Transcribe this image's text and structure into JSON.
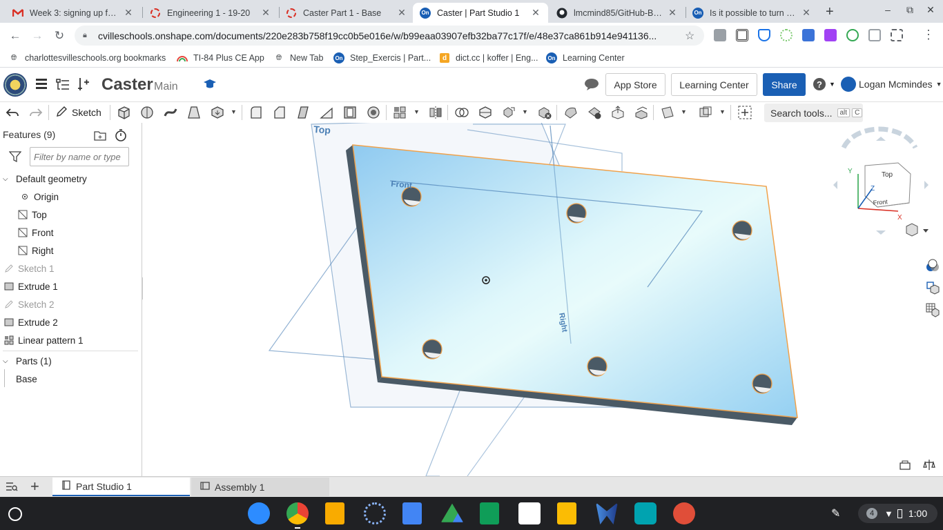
{
  "browser": {
    "tabs": [
      {
        "title": "Week 3: signing up for W",
        "favicon": "gmail-icon"
      },
      {
        "title": "Engineering 1 - 19-20",
        "favicon": "ring-icon"
      },
      {
        "title": "Caster Part 1 - Base",
        "favicon": "ring-icon"
      },
      {
        "title": "Caster | Part Studio 1",
        "favicon": "onshape-icon",
        "active": true
      },
      {
        "title": "lmcmind85/GitHub-Basi",
        "favicon": "github-icon"
      },
      {
        "title": "Is it possible to turn off s",
        "favicon": "onshape-icon"
      }
    ],
    "new_tab": "+",
    "url": "cvilleschools.onshape.com/documents/220e283b758f19cc0b5e016e/w/b99eaa03907efb32ba77c17f/e/48e37ca861b914e941136...",
    "bookmarks": [
      {
        "label": "charlottesvilleschools.org bookmarks",
        "icon": "globe-icon"
      },
      {
        "label": "TI-84 Plus CE App",
        "icon": "rainbow-icon"
      },
      {
        "label": "New Tab",
        "icon": "globe-icon"
      },
      {
        "label": "Step_Exercis | Part...",
        "icon": "onshape-icon"
      },
      {
        "label": "dict.cc | koffer | Eng...",
        "icon": "dict-icon"
      },
      {
        "label": "Learning Center",
        "icon": "onshape-icon"
      }
    ]
  },
  "onshape": {
    "doc_title": "Caster",
    "branch": "Main",
    "buttons": {
      "app_store": "App Store",
      "learning_center": "Learning Center",
      "share": "Share"
    },
    "user_name": "Logan Mcmindes",
    "toolbar": {
      "sketch": "Sketch",
      "search_tools": "Search tools...",
      "kbd_alt": "alt",
      "kbd_c": "C"
    },
    "features": {
      "header": "Features (9)",
      "filter_placeholder": "Filter by name or type",
      "default_geometry": "Default geometry",
      "items": [
        {
          "label": "Origin",
          "type": "origin"
        },
        {
          "label": "Top",
          "type": "plane"
        },
        {
          "label": "Front",
          "type": "plane"
        },
        {
          "label": "Right",
          "type": "plane"
        },
        {
          "label": "Sketch 1",
          "type": "sketch"
        },
        {
          "label": "Extrude 1",
          "type": "extrude"
        },
        {
          "label": "Sketch 2",
          "type": "sketch"
        },
        {
          "label": "Extrude 2",
          "type": "extrude"
        },
        {
          "label": "Linear pattern 1",
          "type": "pattern"
        }
      ],
      "parts_header": "Parts (1)",
      "parts": [
        "Base"
      ]
    },
    "viewport": {
      "plane_labels": {
        "top": "Top",
        "front": "Front",
        "right": "Right"
      },
      "view_cube": {
        "top": "Top",
        "front": "Front",
        "axis_x": "X",
        "axis_y": "Y",
        "axis_z": "Z"
      },
      "colors": {
        "part_face": "#9fd4f2",
        "part_edge": "#f0a14a",
        "part_side": "#4a5a66",
        "plane": "#4a7fb5"
      }
    },
    "bottom_tabs": [
      {
        "label": "Part Studio 1",
        "active": true
      },
      {
        "label": "Assembly 1"
      }
    ]
  },
  "system": {
    "notification_count": "4",
    "time": "1:00"
  }
}
